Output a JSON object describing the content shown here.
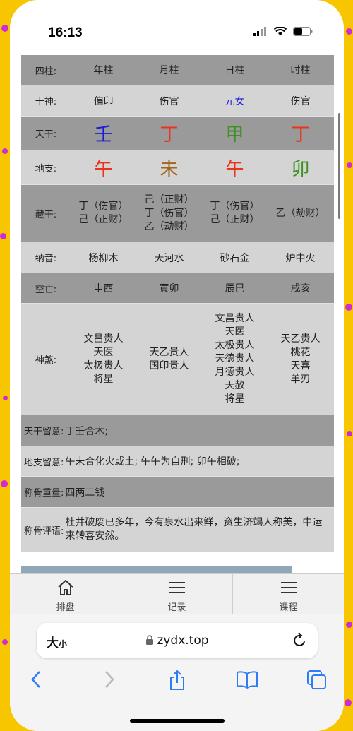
{
  "status_bar": {
    "time": "16:13"
  },
  "bazi": {
    "header": {
      "label": "四柱:",
      "cols": [
        "年柱",
        "月柱",
        "日柱",
        "时柱"
      ]
    },
    "shishen": {
      "label": "十神:",
      "cols": [
        "偏印",
        "伤官",
        "元女",
        "伤官"
      ]
    },
    "tiangan": {
      "label": "天干:",
      "cols": [
        "壬",
        "丁",
        "甲",
        "丁"
      ]
    },
    "dizhi": {
      "label": "地支:",
      "cols": [
        "午",
        "未",
        "午",
        "卯"
      ]
    },
    "canggan": {
      "label": "藏干:",
      "cols": [
        [
          "丁（伤官）",
          "己（正财）"
        ],
        [
          "己（正财）",
          "丁（伤官）",
          "乙（劫财）"
        ],
        [
          "丁（伤官）",
          "己（正财）"
        ],
        [
          "乙（劫财）"
        ]
      ]
    },
    "nayin": {
      "label": "纳音:",
      "cols": [
        "杨柳木",
        "天河水",
        "砂石金",
        "炉中火"
      ]
    },
    "kongwang": {
      "label": "空亡:",
      "cols": [
        "申酉",
        "寅卯",
        "辰巳",
        "戌亥"
      ]
    },
    "shensha": {
      "label": "神煞:",
      "cols": [
        [
          "文昌贵人",
          "天医",
          "太极贵人",
          "将星"
        ],
        [
          "天乙贵人",
          "国印贵人"
        ],
        [
          "文昌贵人",
          "天医",
          "太极贵人",
          "天德贵人",
          "月德贵人",
          "天赦",
          "将星"
        ],
        [
          "天乙贵人",
          "桃花",
          "天喜",
          "羊刃"
        ]
      ]
    },
    "tiangan_liuyi": {
      "label": "天干留意:",
      "value": "丁壬合木;"
    },
    "dizhi_liuyi": {
      "label": "地支留意:",
      "value": "午未合化火或土; 午午为自刑; 卯午相破;"
    },
    "chenggu_weight": {
      "label": "称骨重量:",
      "value": "四两二钱"
    },
    "chenggu_comment": {
      "label": "称骨评语:",
      "value": "杜井破废已多年，今有泉水出来鲜，资生济竭人称美，中运来转喜安然。"
    }
  },
  "colors": {
    "tiangan": [
      "#1a1adb",
      "#e8341c",
      "#3a8f1e",
      "#e8341c"
    ],
    "dizhi": [
      "#e8341c",
      "#a0661a",
      "#e8341c",
      "#3a8f1e"
    ],
    "yuannv": "#1a1adb"
  },
  "tabs": [
    {
      "label": "排盘",
      "icon": "home-icon"
    },
    {
      "label": "记录",
      "icon": "menu-icon"
    },
    {
      "label": "课程",
      "icon": "menu-icon"
    }
  ],
  "browser": {
    "size_label": "大",
    "size_label_small": "小",
    "url": "zydx.top"
  }
}
